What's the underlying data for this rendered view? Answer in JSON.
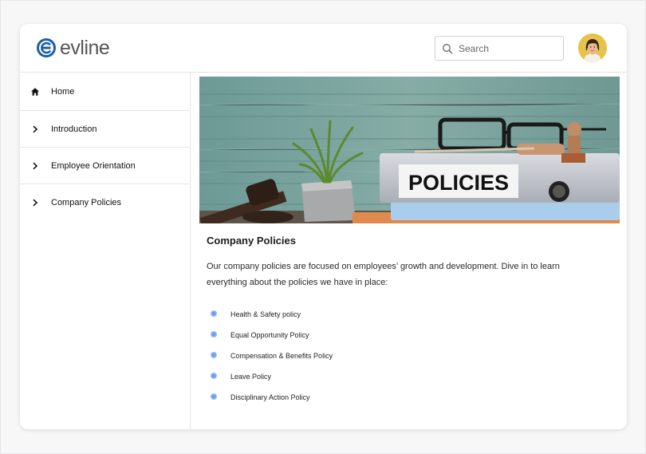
{
  "app": {
    "brand_name": "evline",
    "brand_color": "#1b5fa8"
  },
  "header": {
    "search": {
      "placeholder": "Search",
      "icon": "search-icon"
    },
    "avatar": {
      "icon": "user-avatar"
    }
  },
  "sidebar": {
    "items": [
      {
        "label": "Home",
        "icon": "home-icon"
      },
      {
        "label": "Introduction",
        "icon": "chevron-right-icon"
      },
      {
        "label": "Employee Orientation",
        "icon": "chevron-right-icon"
      },
      {
        "label": "Company Policies",
        "icon": "chevron-right-icon"
      }
    ]
  },
  "main": {
    "hero_sign_text": "POLICIES",
    "title": "Company Policies",
    "intro": "Our company policies are focused on employees’ growth and development. Dive in to learn everything about the policies we have in place:",
    "policies": [
      "Health & Safety policy",
      "Equal Opportunity Policy",
      "Compensation & Benefits Policy",
      "Leave Policy",
      "Disciplinary Action Policy"
    ],
    "bullet_color": "#5c8ff0"
  }
}
